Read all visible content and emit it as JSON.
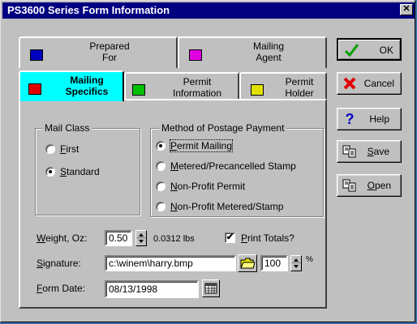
{
  "window": {
    "title": "PS3600 Series Form Information",
    "close_glyph": "✕"
  },
  "tabs": {
    "prepared_for": {
      "label": "Prepared For",
      "color": "#0000c0"
    },
    "mailing_agent": {
      "label": "Mailing Agent",
      "color": "#e000e0"
    },
    "mailing_specifics": {
      "label": "Mailing Specifics",
      "color": "#e00000"
    },
    "permit_information": {
      "label": "Permit Information",
      "color": "#00c000"
    },
    "permit_holder": {
      "label": "Permit Holder",
      "color": "#e0e000"
    }
  },
  "mail_class": {
    "legend": "Mail Class",
    "options": [
      {
        "label": "First",
        "selected": false
      },
      {
        "label": "Standard",
        "selected": true
      }
    ]
  },
  "postage_payment": {
    "legend": "Method of Postage Payment",
    "options": [
      {
        "label": "Permit Mailing",
        "selected": true
      },
      {
        "label": "Metered/Precancelled Stamp",
        "selected": false
      },
      {
        "label": "Non-Profit Permit",
        "selected": false
      },
      {
        "label": "Non-Profit Metered/Stamp",
        "selected": false
      }
    ]
  },
  "weight": {
    "label": "Weight, Oz:",
    "value": "0.50",
    "lbs": "0.0312 lbs"
  },
  "print_totals": {
    "label": "Print Totals?",
    "checked": true,
    "check_glyph": "✔"
  },
  "signature": {
    "label": "Signature:",
    "path": "c:\\winem\\harry.bmp",
    "scale": "100",
    "unit": "%"
  },
  "form_date": {
    "label": "Form Date:",
    "value": "08/13/1998"
  },
  "buttons": {
    "ok": "OK",
    "cancel": "Cancel",
    "help": "Help",
    "save": "Save",
    "open": "Open"
  },
  "icons": {
    "ok": "check-icon",
    "cancel": "x-icon",
    "help": "question-icon",
    "save": "save-document-icon",
    "open": "open-document-icon",
    "folder": "folder-icon",
    "calendar": "calendar-icon"
  },
  "colors": {
    "title_bar": "#000080",
    "active_tab": "#00ffff",
    "ok_check": "#00a000",
    "cancel_x": "#e00000"
  }
}
